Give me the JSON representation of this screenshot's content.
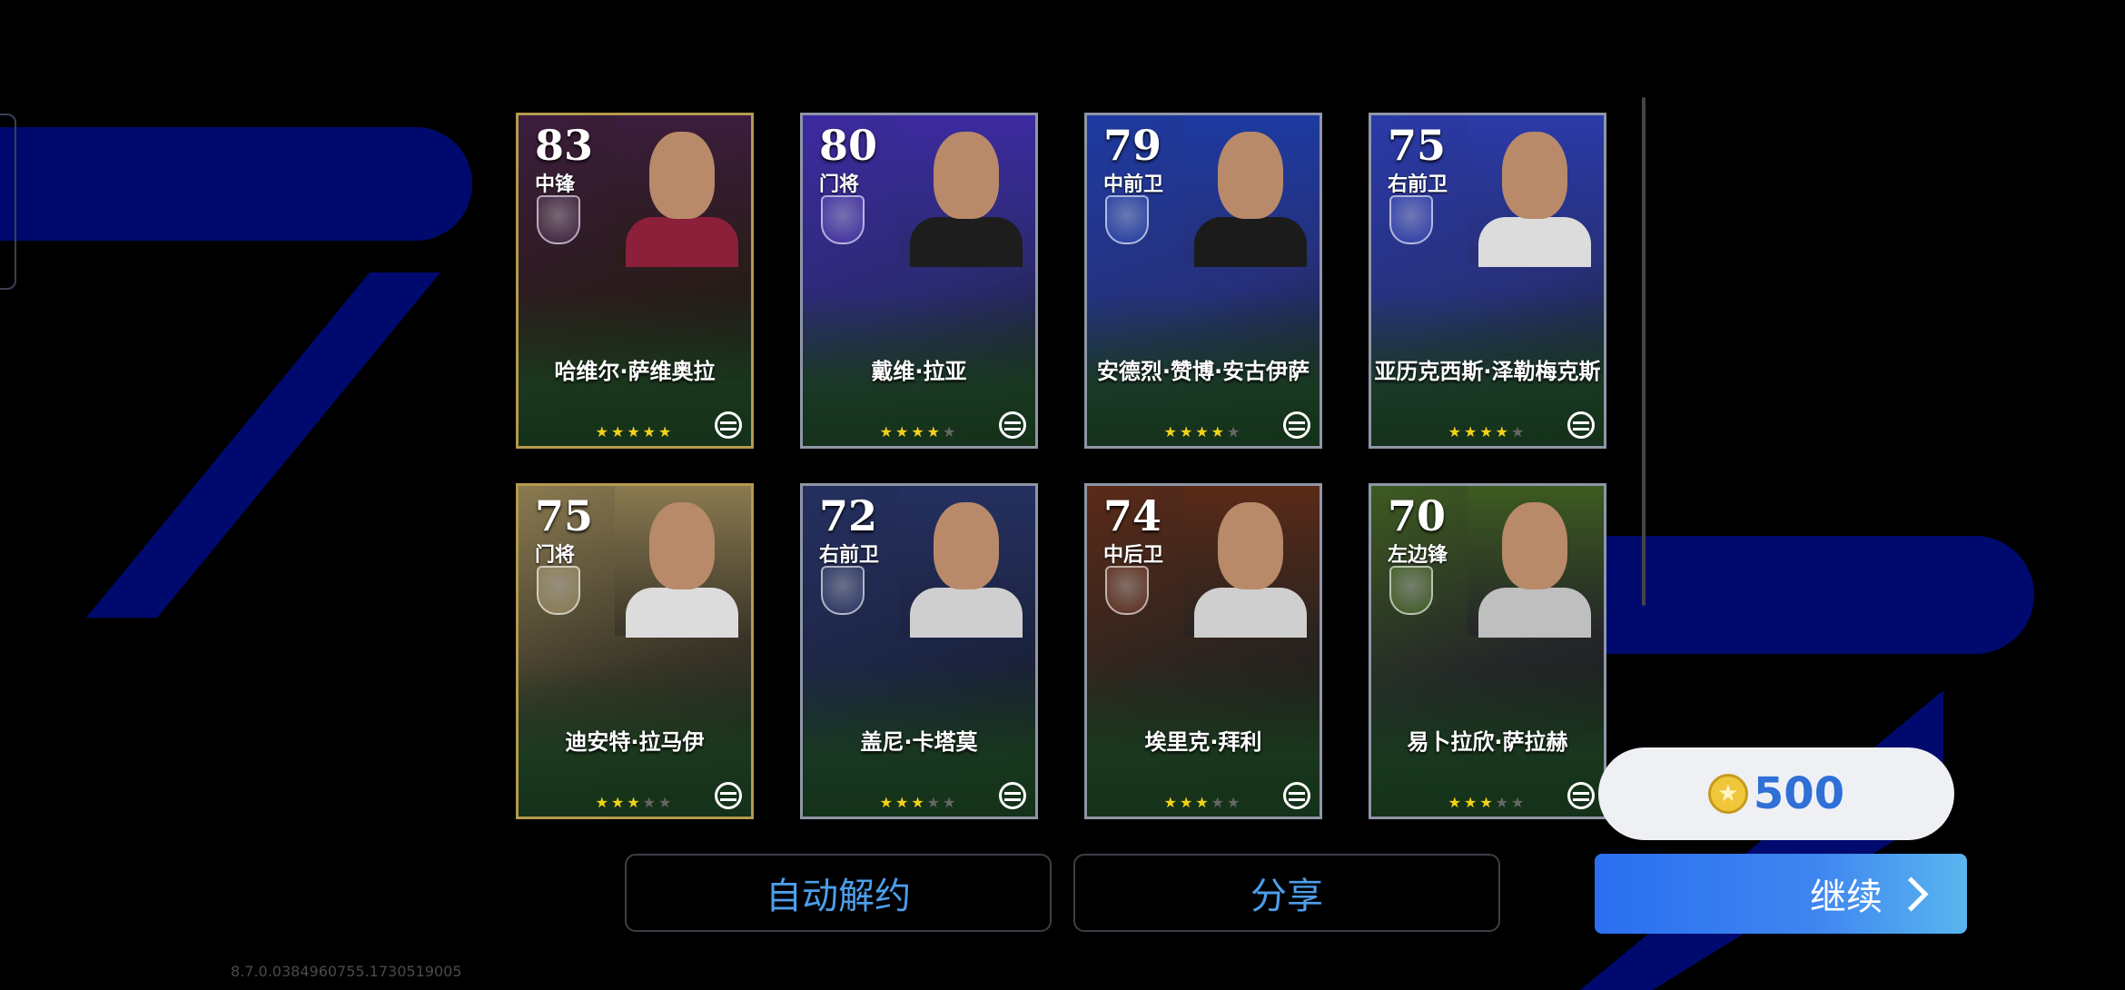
{
  "cards": [
    {
      "rating": "83",
      "position": "中锋",
      "name": "哈维尔·萨维奥拉",
      "stars": 5,
      "style": "gold",
      "bg": "#2a1c1a",
      "photo": "#3b1d3d",
      "shirt": "#8c1f3a"
    },
    {
      "rating": "80",
      "position": "门将",
      "name": "戴维·拉亚",
      "stars": 4,
      "style": "blue",
      "bg": "#2a2a70",
      "photo": "#3d2aa0",
      "shirt": "#1d1d1d"
    },
    {
      "rating": "79",
      "position": "中前卫",
      "name": "安德烈·赞博·安古伊萨",
      "stars": 4,
      "style": "blue",
      "bg": "#26307a",
      "photo": "#1d3aa0",
      "shirt": "#1b1b1b"
    },
    {
      "rating": "75",
      "position": "右前卫",
      "name": "亚历克西斯·泽勒梅克斯",
      "stars": 4,
      "style": "blue",
      "bg": "#273078",
      "photo": "#2a3aa8",
      "shirt": "#dcdcdc"
    },
    {
      "rating": "75",
      "position": "门将",
      "name": "迪安特·拉马伊",
      "stars": 3,
      "style": "gold",
      "bg": "#3a3528",
      "photo": "#8a7a50",
      "shirt": "#dcdcdc"
    },
    {
      "rating": "72",
      "position": "右前卫",
      "name": "盖尼·卡塔莫",
      "stars": 3,
      "style": "navy",
      "bg": "#1c2442",
      "photo": "#253060",
      "shirt": "#cfcfcf"
    },
    {
      "rating": "74",
      "position": "中后卫",
      "name": "埃里克·拜利",
      "stars": 3,
      "style": "orange",
      "bg": "#2a2420",
      "photo": "#5a2a18",
      "shirt": "#cfcfcf"
    },
    {
      "rating": "70",
      "position": "左边锋",
      "name": "易卜拉欣·萨拉赫",
      "stars": 3,
      "style": "lime",
      "bg": "#242628",
      "photo": "#3d5a20",
      "shirt": "#bfbfbf"
    }
  ],
  "buttons": {
    "auto_release": "自动解约",
    "share": "分享",
    "continue": "继续"
  },
  "coins": {
    "amount": "500",
    "icon": "star-coin-icon"
  },
  "version": "8.7.0.0384960755.1730519005",
  "colors": {
    "accent": "#4d9eea",
    "continue_start": "#2a6ff0",
    "continue_end": "#58b6ee",
    "coin_text": "#2f6fd6"
  }
}
